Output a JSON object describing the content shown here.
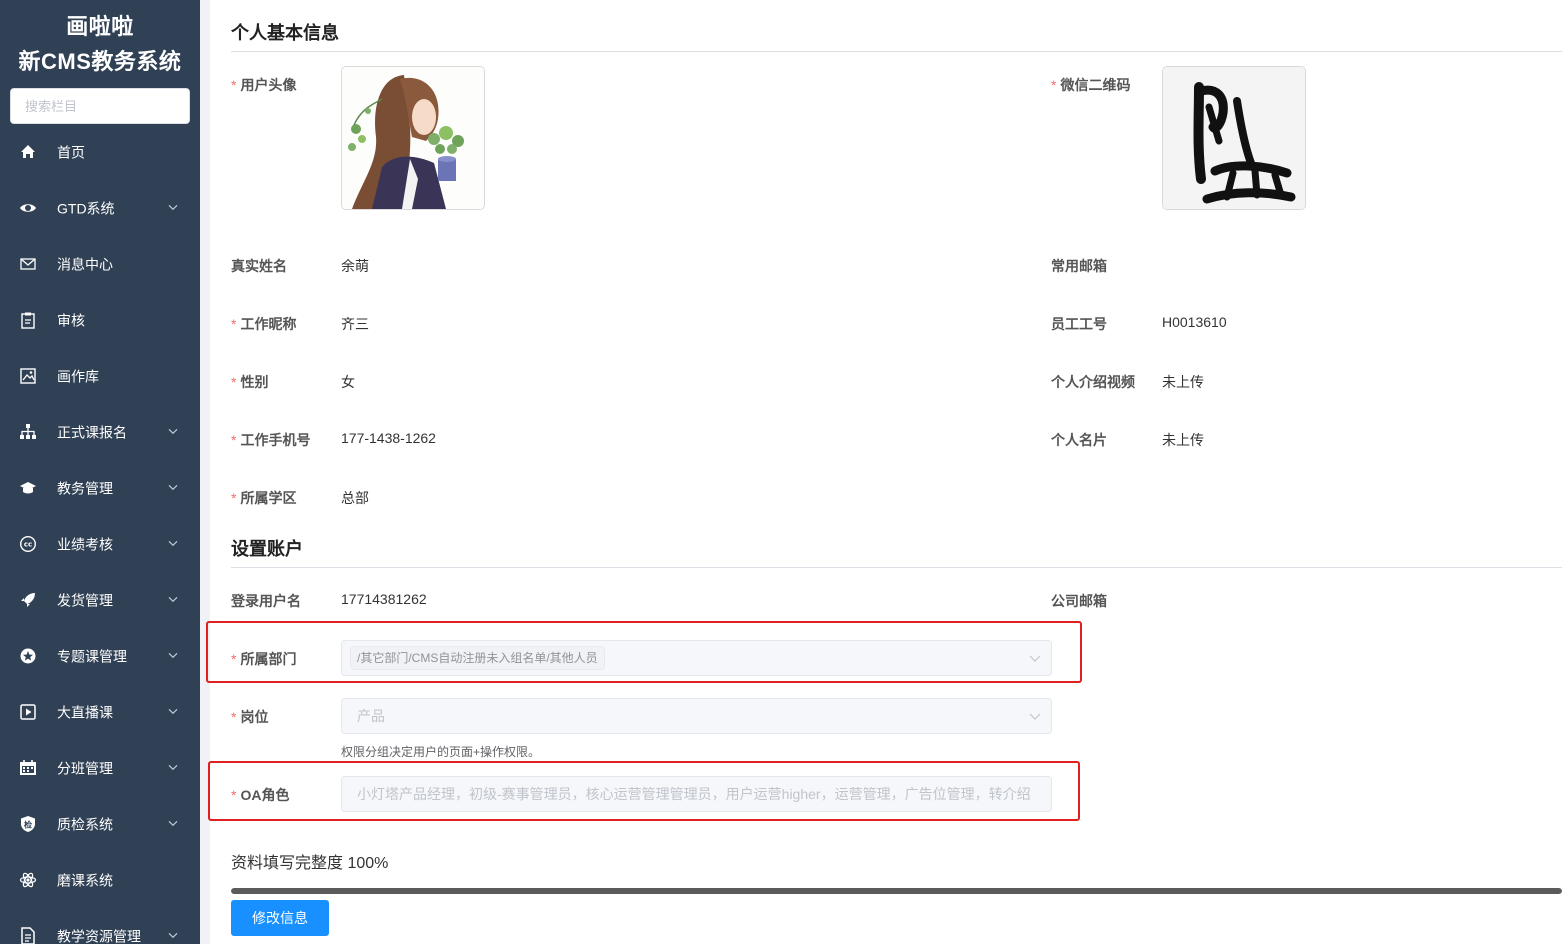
{
  "sidebar": {
    "brand_line1": "画啦啦",
    "brand_line2": "新CMS教务系统",
    "search_placeholder": "搜索栏目",
    "items": [
      {
        "label": "首页",
        "icon": "home-icon",
        "has_children": false
      },
      {
        "label": "GTD系统",
        "icon": "eye-icon",
        "has_children": true
      },
      {
        "label": "消息中心",
        "icon": "mail-icon",
        "has_children": false
      },
      {
        "label": "审核",
        "icon": "clipboard-icon",
        "has_children": false
      },
      {
        "label": "画作库",
        "icon": "picture-icon",
        "has_children": false
      },
      {
        "label": "正式课报名",
        "icon": "sitemap-icon",
        "has_children": true
      },
      {
        "label": "教务管理",
        "icon": "graduation-cap-icon",
        "has_children": true
      },
      {
        "label": "业绩考核",
        "icon": "cc-icon",
        "has_children": true
      },
      {
        "label": "发货管理",
        "icon": "rocket-icon",
        "has_children": true
      },
      {
        "label": "专题课管理",
        "icon": "star-circle-icon",
        "has_children": true
      },
      {
        "label": "大直播课",
        "icon": "video-play-icon",
        "has_children": true
      },
      {
        "label": "分班管理",
        "icon": "calendar-icon",
        "has_children": true
      },
      {
        "label": "质检系统",
        "icon": "shield-check-icon",
        "has_children": true
      },
      {
        "label": "磨课系统",
        "icon": "atom-icon",
        "has_children": false
      },
      {
        "label": "教学资源管理",
        "icon": "document-icon",
        "has_children": true
      }
    ]
  },
  "basic": {
    "title": "个人基本信息",
    "avatar_label": "用户头像",
    "wechat_label": "微信二维码",
    "real_name_label": "真实姓名",
    "real_name": "余萌",
    "email_label": "常用邮箱",
    "email": "",
    "nickname_label": "工作昵称",
    "nickname": "齐三",
    "employee_id_label": "员工工号",
    "employee_id": "H0013610",
    "gender_label": "性别",
    "gender": "女",
    "video_label": "个人介绍视频",
    "video": "未上传",
    "phone_label": "工作手机号",
    "phone": "177-1438-1262",
    "card_label": "个人名片",
    "card": "未上传",
    "district_label": "所属学区",
    "district": "总部"
  },
  "account": {
    "title": "设置账户",
    "username_label": "登录用户名",
    "username": "17714381262",
    "company_email_label": "公司邮箱",
    "company_email": "",
    "dept_label": "所属部门",
    "dept_value": "/其它部门/CMS自动注册未入组名单/其他人员",
    "position_label": "岗位",
    "position_placeholder": "产品",
    "position_hint": "权限分组决定用户的页面+操作权限。",
    "oa_label": "OA角色",
    "oa_placeholder": "小灯塔产品经理，初级-赛事管理员，核心运营管理管理员，用户运营higher，运营管理，广告位管理，转介绍"
  },
  "completion": {
    "label": "资料填写完整度",
    "percent_text": "100%",
    "fraction": 1.0
  },
  "edit_button": "修改信息",
  "colors": {
    "sidebar_bg": "#304156",
    "primary": "#1890ff",
    "required": "#f56c6c",
    "highlight": "#e02020"
  }
}
